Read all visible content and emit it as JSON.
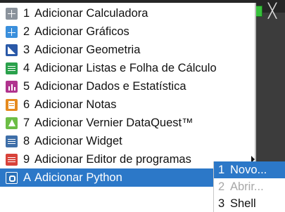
{
  "window": {
    "close_glyph": "╳"
  },
  "main_menu": {
    "items": [
      {
        "num": "1",
        "label": "Adicionar Calculadora",
        "icon": "calculator-icon",
        "icon_color": "#8b939c"
      },
      {
        "num": "2",
        "label": "Adicionar Gráficos",
        "icon": "graphs-icon",
        "icon_color": "#3a8fdc"
      },
      {
        "num": "3",
        "label": "Adicionar Geometria",
        "icon": "geometry-icon",
        "icon_color": "#2a59a8"
      },
      {
        "num": "4",
        "label": "Adicionar Listas e Folha de Cálculo",
        "icon": "spreadsheet-icon",
        "icon_color": "#2aa14b"
      },
      {
        "num": "5",
        "label": "Adicionar Dados e Estatística",
        "icon": "data-stats-icon",
        "icon_color": "#b0338e"
      },
      {
        "num": "6",
        "label": "Adicionar Notas",
        "icon": "notes-icon",
        "icon_color": "#e58a1f"
      },
      {
        "num": "7",
        "label": "Adicionar Vernier DataQuest™",
        "icon": "vernier-icon",
        "icon_color": "#6cbd45"
      },
      {
        "num": "8",
        "label": "Adicionar Widget",
        "icon": "widget-icon",
        "icon_color": "#3e6ea8"
      },
      {
        "num": "9",
        "label": "Adicionar Editor de programas",
        "icon": "program-editor-icon",
        "icon_color": "#d8423a"
      },
      {
        "num": "A",
        "label": "Adicionar Python",
        "icon": "python-icon",
        "icon_color": "#2b71b8",
        "selected": true
      }
    ]
  },
  "submenu": {
    "items": [
      {
        "num": "1",
        "label": "Novo...",
        "selected": true
      },
      {
        "num": "2",
        "label": "Abrir...",
        "disabled": true
      },
      {
        "num": "3",
        "label": "Shell"
      }
    ]
  },
  "colors": {
    "selection": "#2c78c8",
    "battery": "#37c13c"
  }
}
